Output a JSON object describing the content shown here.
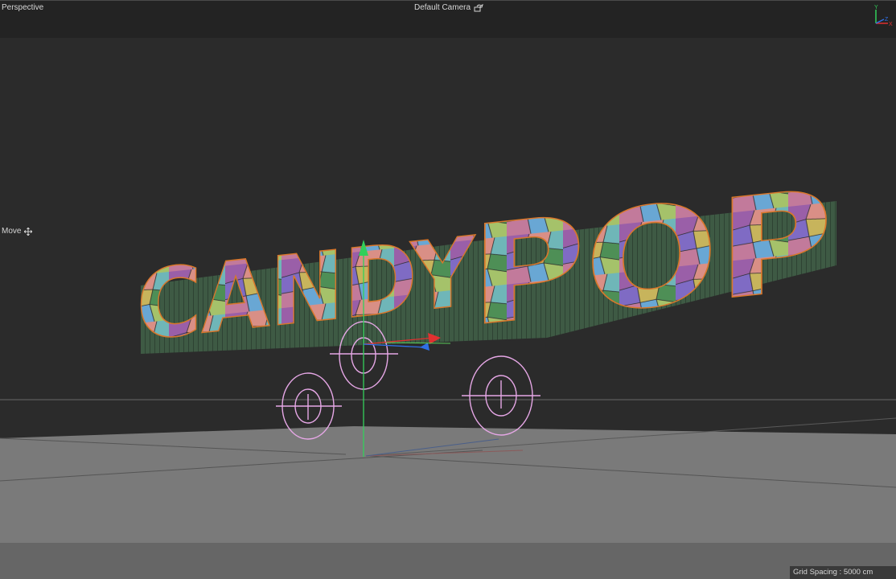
{
  "viewport": {
    "view_mode": "Perspective",
    "camera_label": "Default Camera",
    "active_tool": "Move",
    "grid_spacing": "Grid Spacing : 5000 cm",
    "axis_labels": {
      "y": "Y",
      "z": "Z",
      "x": "X"
    },
    "scene_text": "CANDY POP"
  },
  "colors": {
    "background": "#2b2b2b",
    "topbar": "#232323",
    "floor": "#7a7a7a",
    "selection_outline": "#d9772b",
    "wheel_rig": "#e6a7e6",
    "axis_y": "#32d05a",
    "axis_x": "#e03030",
    "axis_z": "#2f6fe6"
  },
  "icons": [
    "camera-orbit-icon",
    "move-tool-icon",
    "axis-gizmo-icon"
  ]
}
